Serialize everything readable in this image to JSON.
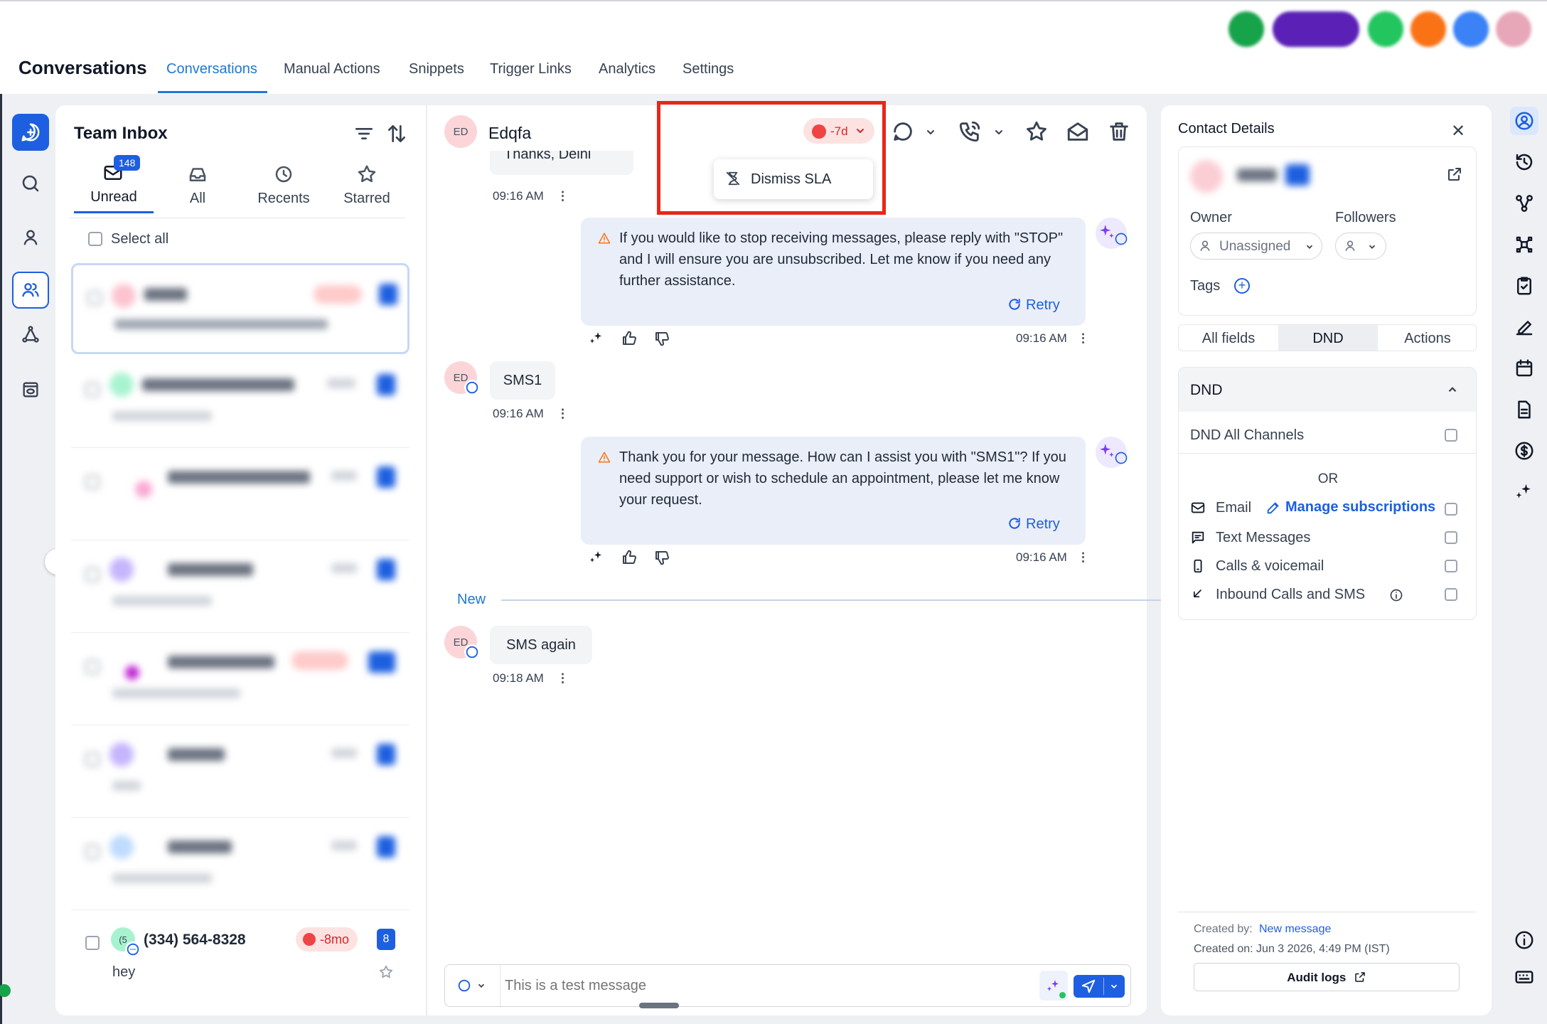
{
  "header": {
    "app_title": "Conversations",
    "tabs": [
      "Conversations",
      "Manual Actions",
      "Snippets",
      "Trigger Links",
      "Analytics",
      "Settings"
    ],
    "active_tab": "Conversations",
    "top_buttons": [
      "phone-icon",
      "ask-ai-button",
      "notifications-icon",
      "updates-icon",
      "help-icon",
      "user-avatar"
    ]
  },
  "inbox": {
    "title": "Team Inbox",
    "unread_count": "148",
    "filter_tabs": [
      "Unread",
      "All",
      "Recents",
      "Starred"
    ],
    "select_all": "Select all",
    "visible_item": {
      "name": "(334) 564-8328",
      "avatar_initials": "(5",
      "sla": "-8mo",
      "count": "8",
      "preview": "hey"
    }
  },
  "conversation": {
    "contact_initials": "ED",
    "contact_name": "Edqfa",
    "sla_label": "-7d",
    "dropdown_item": "Dismiss SLA",
    "messages": [
      {
        "text": "Thanks, Delhi",
        "time": "09:16 AM"
      },
      {
        "text": "If you would like to stop receiving messages, please reply with \"STOP\" and I will ensure you are unsubscribed. Let me know if you need any further assistance.",
        "retry": "Retry",
        "time": "09:16 AM"
      },
      {
        "text": "SMS1",
        "time": "09:16 AM"
      },
      {
        "text": "Thank you for your message. How can I assist you with \"SMS1\"? If you need support or wish to schedule an appointment, please let me know your request.",
        "retry": "Retry",
        "time": "09:16 AM"
      },
      {
        "text": "SMS again",
        "time": "09:18 AM"
      }
    ],
    "new_divider": "New",
    "composer_placeholder": "This is a test message"
  },
  "contact": {
    "title": "Contact Details",
    "owner_label": "Owner",
    "owner_value": "Unassigned",
    "followers_label": "Followers",
    "tags_label": "Tags",
    "tabs": [
      "All fields",
      "DND",
      "Actions"
    ],
    "active_tab": "DND",
    "dnd_title": "DND",
    "dnd_all": "DND All Channels",
    "or": "OR",
    "channels": [
      "Email",
      "Text Messages",
      "Calls & voicemail",
      "Inbound Calls and SMS"
    ],
    "manage_subs": "Manage subscriptions",
    "created_by_label": "Created by:",
    "created_by_value": "New message",
    "created_on": "Created on: Jun 3 2026, 4:49 PM (IST)",
    "audit_logs": "Audit logs"
  },
  "colors": {
    "accent": "#1d78d6",
    "primary_blue": "#1d5fe0",
    "sla_red": "#ef4444",
    "highlight_box": "#e8261a"
  }
}
